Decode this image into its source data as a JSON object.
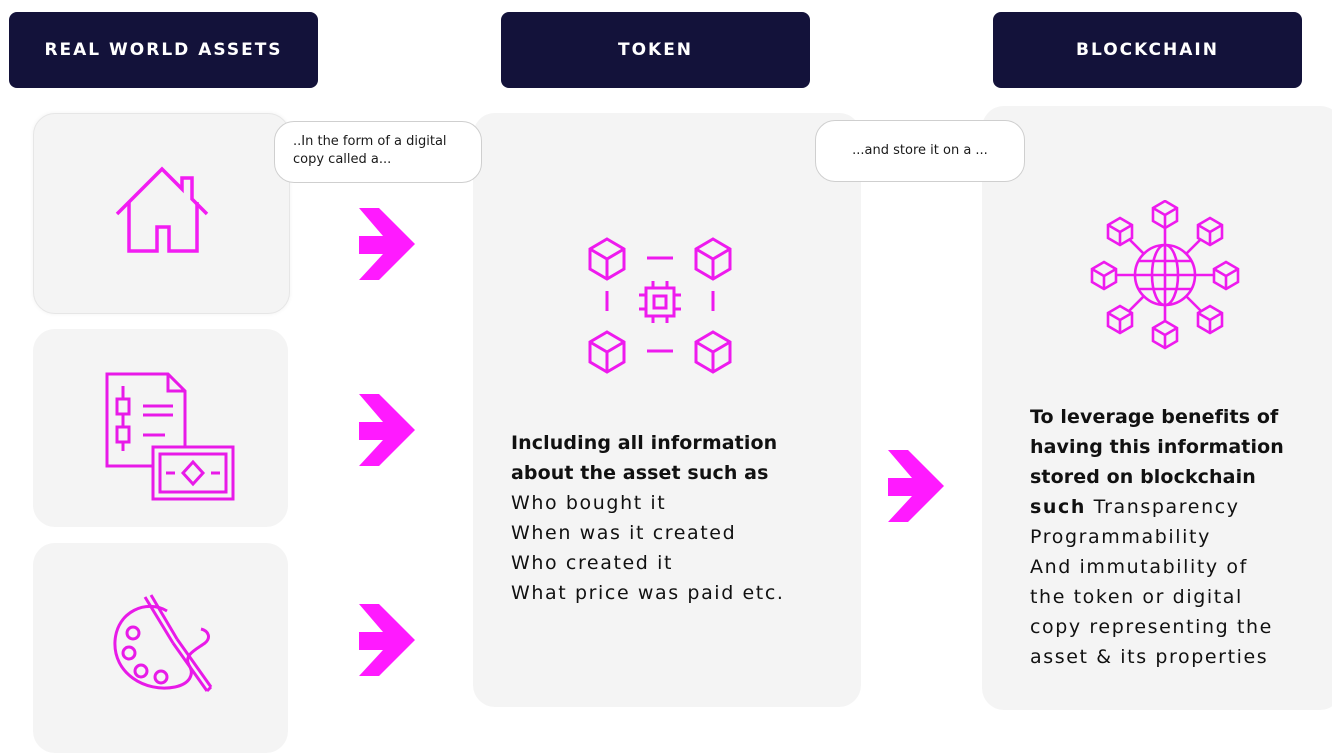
{
  "headers": {
    "assets": "REAL WORLD ASSETS",
    "token": "TOKEN",
    "blockchain": "BLOCKCHAIN"
  },
  "bubbles": {
    "first_line1": "..In the form of a digital",
    "first_line2": "copy called a...",
    "second": "...and store it on a ..."
  },
  "token_text": {
    "bold_line1": "Including all information",
    "bold_line2": "about the asset such as",
    "items": [
      "Who bought it",
      "When was it created",
      "Who created it",
      "What price was paid etc."
    ]
  },
  "blockchain_text": {
    "bold_line1": "To leverage benefits of",
    "bold_line2": "having this information",
    "bold_line3": "stored on blockchain",
    "bold_word": "such",
    "inline_rest": " Transparency",
    "lines": [
      "Programmability",
      "And immutability of",
      "the token or digital",
      "copy representing the",
      "asset & its properties"
    ]
  },
  "icons": {
    "asset1": "house-icon",
    "asset2": "document-money-icon",
    "asset3": "paint-palette-icon",
    "token": "token-chip-cubes-icon",
    "blockchain": "globe-network-icon",
    "arrows": "arrow-right-icon"
  },
  "colors": {
    "accent": "#ff1aff",
    "header_bg": "#13123a",
    "card_bg": "#f4f4f4"
  }
}
